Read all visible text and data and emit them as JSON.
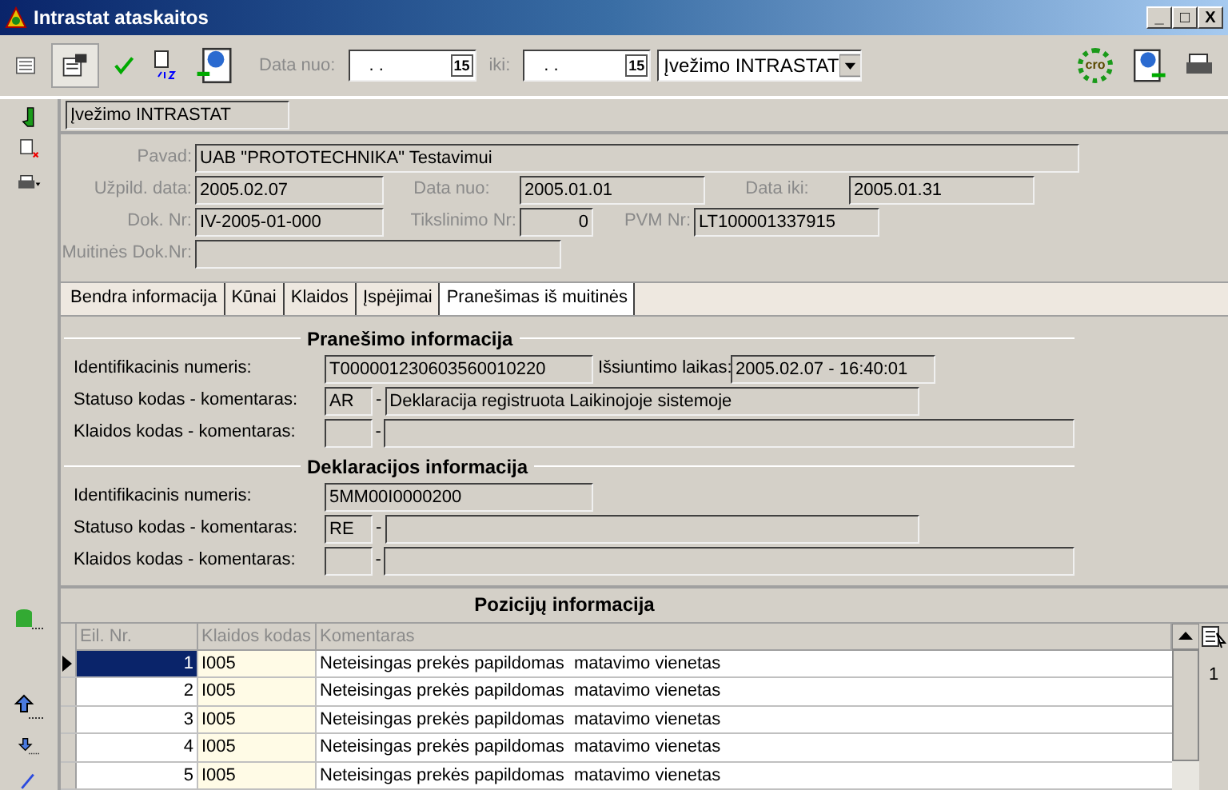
{
  "window": {
    "title": "Intrastat ataskaitos",
    "controls": [
      "_",
      "□",
      "X"
    ]
  },
  "toolbar": {
    "date_from_label": "Data nuo:",
    "date_from": ". .",
    "date_to_label": "iki:",
    "date_to": ". .",
    "calendar_from": "15",
    "calendar_to": "15",
    "type_select": "Įvežimo INTRASTAT",
    "badge_text": "cro"
  },
  "header_field": "Įvežimo INTRASTAT",
  "form": {
    "name_label": "Pavad:",
    "name": "UAB \"PROTOTECHNIKA\" Testavimui",
    "filled_label": "Užpild. data:",
    "filled": "2005.02.07",
    "from_label": "Data nuo:",
    "from": "2005.01.01",
    "to_label": "Data iki:",
    "to": "2005.01.31",
    "doc_label": "Dok. Nr:",
    "doc": "IV-2005-01-000",
    "corr_label": "Tikslinimo Nr:",
    "corr": "0",
    "vat_label": "PVM Nr:",
    "vat": "LT100001337915",
    "customs_label": "Muitinės Dok.Nr:"
  },
  "tabs": [
    {
      "label": "Bendra informacija",
      "selected": false
    },
    {
      "label": "Kūnai",
      "selected": false
    },
    {
      "label": "Klaidos",
      "selected": false
    },
    {
      "label": "Įspėjimai",
      "selected": false
    },
    {
      "label": "Pranešimas iš muitinės",
      "selected": true
    }
  ],
  "sections": [
    {
      "title": "Pranešimo informacija",
      "id_label": "Identifikacinis numeris:",
      "id": "T000001230603560010220",
      "sent_label": "Išsiuntimo laikas:",
      "sent": "2005.02.07 - 16:40:01",
      "status_label": "Statuso kodas - komentaras:",
      "status_code": "AR",
      "status_dash": "-",
      "error_dash": "-",
      "status_comment": "Deklaracija registruota Laikinojoje sistemoje",
      "error_label": "Klaidos kodas - komentaras:"
    },
    {
      "title": "Deklaracijos informacija",
      "id_label": "Identifikacinis numeris:",
      "id": "5MM00I0000200",
      "status_label": "Statuso kodas - komentaras:",
      "status_code": "RE",
      "status_dash": "-",
      "error_dash": "-",
      "error_label": "Klaidos kodas - komentaras:"
    }
  ],
  "table": {
    "title": "Pozicijų informacija",
    "columns": [
      "Eil. Nr.",
      "Klaidos kodas",
      "Komentaras"
    ],
    "rows": [
      {
        "nr": "1",
        "code": "I005",
        "comment": "Neteisingas prekės papildomas  matavimo vienetas",
        "selected": true
      },
      {
        "nr": "2",
        "code": "I005",
        "comment": "Neteisingas prekės papildomas  matavimo vienetas",
        "selected": false
      },
      {
        "nr": "3",
        "code": "I005",
        "comment": "Neteisingas prekės papildomas  matavimo vienetas",
        "selected": false
      },
      {
        "nr": "4",
        "code": "I005",
        "comment": "Neteisingas prekės papildomas  matavimo vienetas",
        "selected": false
      },
      {
        "nr": "5",
        "code": "I005",
        "comment": "Neteisingas prekės papildomas  matavimo vienetas",
        "selected": false
      }
    ],
    "side_count": "1"
  }
}
